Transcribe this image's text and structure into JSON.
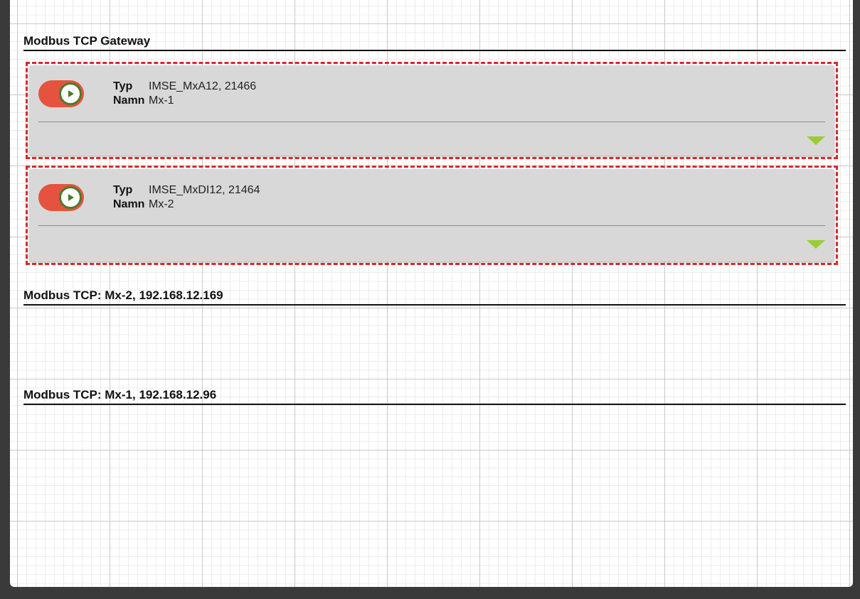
{
  "sections": {
    "gateway": {
      "title": "Modbus TCP Gateway"
    },
    "mx2": {
      "title": "Modbus TCP: Mx-2, 192.168.12.169"
    },
    "mx1": {
      "title": "Modbus TCP: Mx-1, 192.168.12.96"
    }
  },
  "devices": [
    {
      "typ_label": "Typ",
      "typ_value": "IMSE_MxA12, 21466",
      "namn_label": "Namn",
      "namn_value": "Mx-1",
      "toggle_icon": "play-icon",
      "expand_icon": "chevron-down-icon"
    },
    {
      "typ_label": "Typ",
      "typ_value": "IMSE_MxDI12, 21464",
      "namn_label": "Namn",
      "namn_value": "Mx-2",
      "toggle_icon": "play-icon",
      "expand_icon": "chevron-down-icon"
    }
  ],
  "colors": {
    "toggle": "#e5533e",
    "toggle_knob_border": "#4d7a2b",
    "selection_border": "#d62a2a",
    "expand_arrow": "#9acd32",
    "card_bg": "#d8d8d8"
  }
}
